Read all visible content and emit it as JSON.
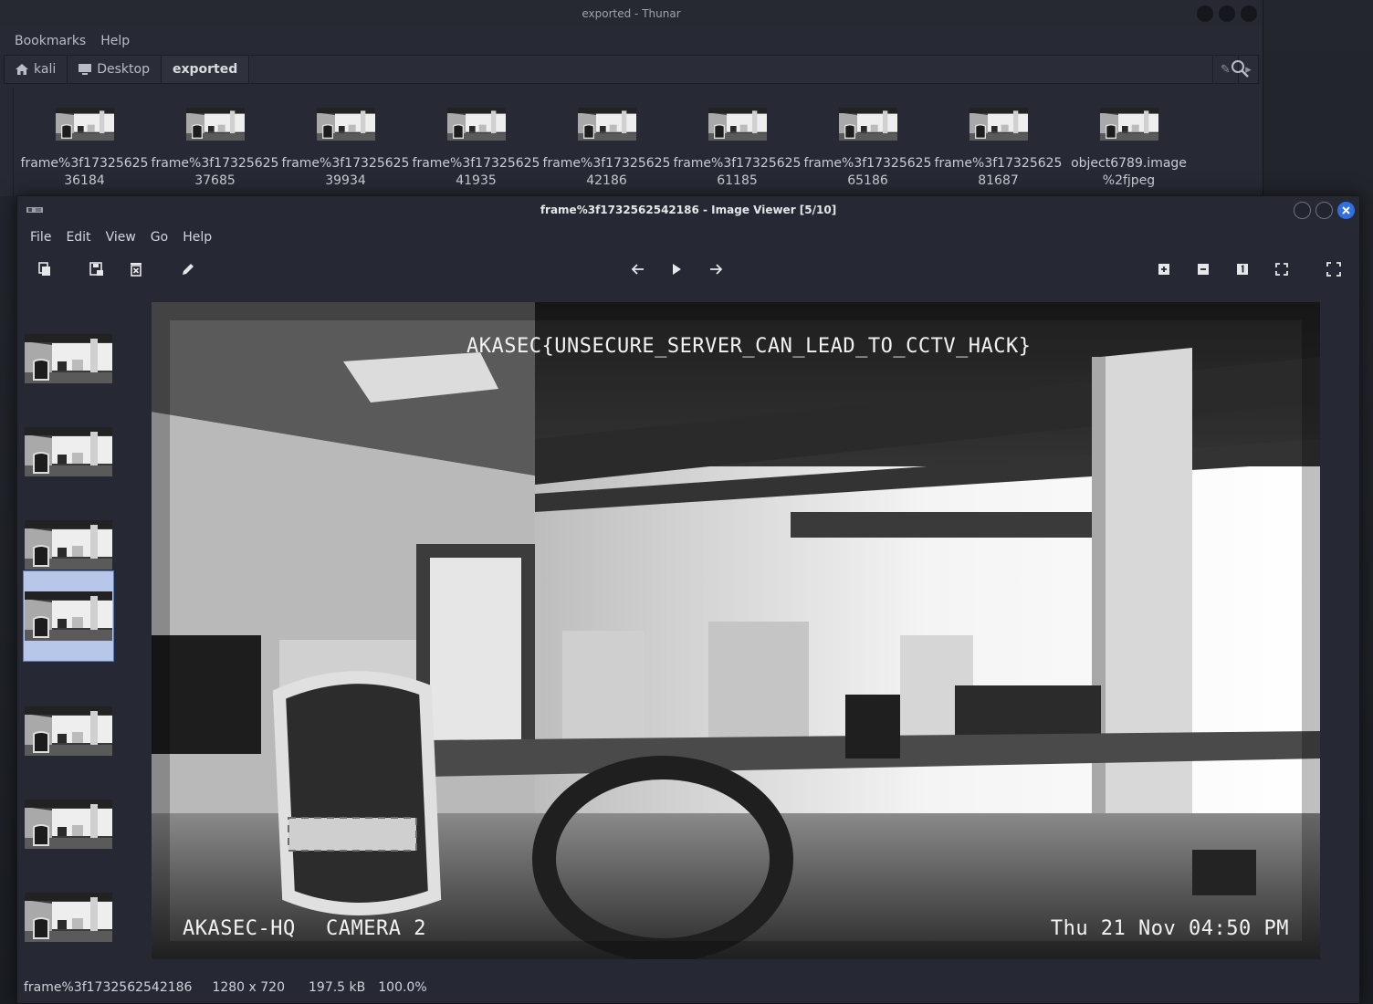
{
  "thunar": {
    "title": "exported - Thunar",
    "menu": [
      "Bookmarks",
      "Help"
    ],
    "breadcrumbs": [
      {
        "label": "kali",
        "icon": "home-icon"
      },
      {
        "label": "Desktop",
        "icon": "desktop-icon"
      },
      {
        "label": "exported",
        "icon": ""
      }
    ],
    "files": [
      {
        "line1": "frame%3f17325625",
        "line2": "36184"
      },
      {
        "line1": "frame%3f17325625",
        "line2": "37685"
      },
      {
        "line1": "frame%3f17325625",
        "line2": "39934"
      },
      {
        "line1": "frame%3f17325625",
        "line2": "41935"
      },
      {
        "line1": "frame%3f17325625",
        "line2": "42186"
      },
      {
        "line1": "frame%3f17325625",
        "line2": "61185"
      },
      {
        "line1": "frame%3f17325625",
        "line2": "65186"
      },
      {
        "line1": "frame%3f17325625",
        "line2": "81687"
      },
      {
        "line1": "object6789.image",
        "line2": "%2fjpeg"
      }
    ]
  },
  "viewer": {
    "title": "frame%3f1732562542186 - Image Viewer [5/10]",
    "menu": [
      "File",
      "Edit",
      "View",
      "Go",
      "Help"
    ],
    "toolbar_icons": [
      "open-icon",
      "save-icon",
      "delete-icon",
      "edit-icon",
      "previous-arrow-icon",
      "play-icon",
      "next-arrow-icon",
      "zoom-in-icon",
      "zoom-out-icon",
      "zoom-100-icon",
      "zoom-fit-icon",
      "fullscreen-icon"
    ],
    "selected_thumbnail_index": 3,
    "image_overlay": {
      "flag": "AKASEC{UNSECURE_SERVER_CAN_LEAD_TO_CCTV_HACK}",
      "location": "AKASEC-HQ",
      "camera": "CAMERA 2",
      "timestamp": "Thu 21 Nov 04:50 PM"
    },
    "status": {
      "filename": "frame%3f1732562542186",
      "dimensions": "1280 x 720",
      "size": "197.5 kB",
      "zoom": "100.0%"
    }
  },
  "colors": {
    "accent": "#2f6fe0",
    "selection": "#b7c7ea",
    "window_bg": "#262933"
  }
}
